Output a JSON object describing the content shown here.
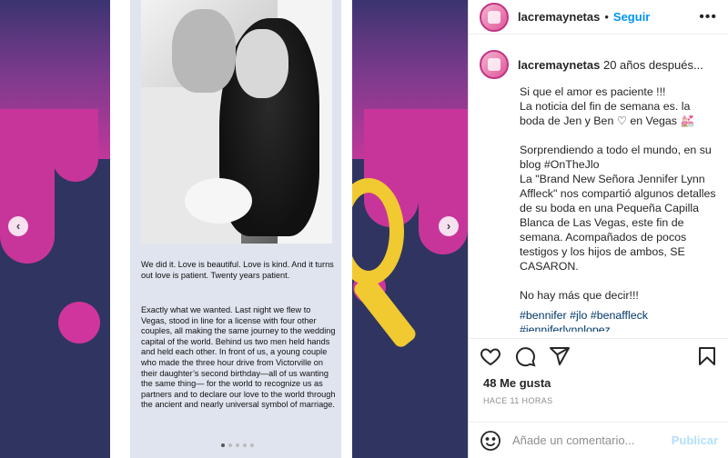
{
  "media": {
    "card_text_1": "We did it. Love is beautiful. Love is kind. And it turns out love is patient. Twenty years patient.",
    "card_text_2": "Exactly what we wanted. Last night we flew to Vegas, stood in line for a license with four other couples, all making the same journey to the wedding capital of the world. Behind us two men held hands and held each other. In front of us, a young couple who made the three hour drive from Victorville on their daughter’s second birthday—all of us wanting the same thing— for the world to recognize us as partners and to declare our love to the world through the ancient and nearly universal symbol of marriage.",
    "prev_arrow": "‹",
    "next_arrow": "›"
  },
  "header": {
    "username": "lacremaynetas",
    "separator": "•",
    "follow_label": "Seguir",
    "more_label": "•••"
  },
  "caption": {
    "username": "lacremaynetas",
    "intro": "20 años después...",
    "body": "Si que el amor es paciente !!!\nLa noticia del fin de semana es. la boda de Jen y Ben ♡ en Vegas 💒\n\nSorprendiendo a todo el mundo, en su blog #OnTheJlo\nLa \"Brand New Señora Jennifer Lynn Affleck\" nos compartió algunos detalles de su boda en una Pequeña Capilla Blanca de Las Vegas, este fin de semana. Acompañados de pocos testigos y los hijos de ambos, SE CASARON.\n\nNo hay más que decir!!!",
    "hashtags_line1": "#bennifer #jlo #benaffleck",
    "hashtags_line2": "#jenniferlynnlopez"
  },
  "likes_label": "48 Me gusta",
  "time_label": "HACE 11 HORAS",
  "comment": {
    "placeholder": "Añade un comentario...",
    "post_label": "Publicar"
  },
  "colors": {
    "follow": "#0095f6",
    "hashtag": "#00376b",
    "publish_disabled": "#b2dffc",
    "media_magenta": "#c8359a",
    "media_yellow": "#f1c930"
  },
  "icons": [
    "heart-icon",
    "comment-icon",
    "share-icon",
    "bookmark-icon",
    "smiley-icon",
    "more-icon"
  ]
}
